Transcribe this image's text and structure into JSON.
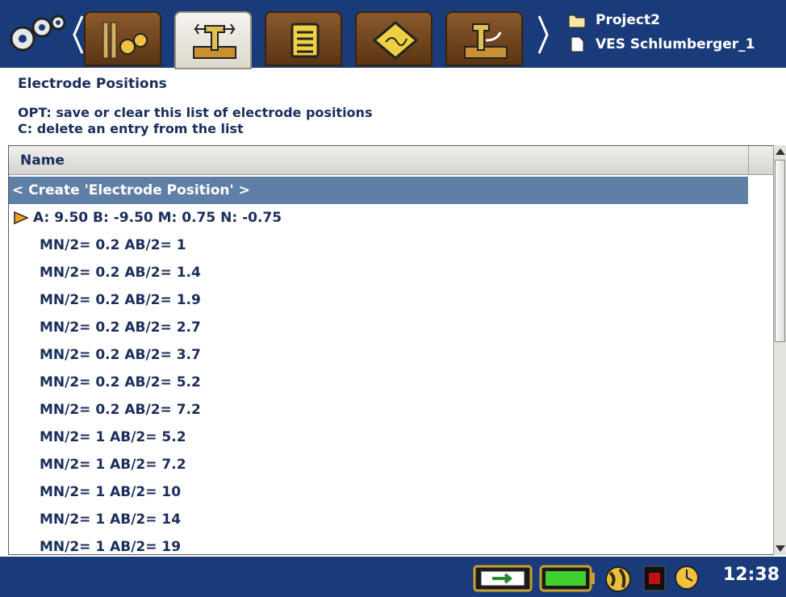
{
  "header": {
    "project_name": "Project2",
    "survey_name": "VES Schlumberger_1",
    "tabs": [
      {
        "icon": "settings-geophones-icon",
        "active": false
      },
      {
        "icon": "survey-setup-icon",
        "active": true
      },
      {
        "icon": "notes-list-icon",
        "active": false
      },
      {
        "icon": "data-viewer-icon",
        "active": false
      },
      {
        "icon": "electrode-measure-icon",
        "active": false
      }
    ]
  },
  "page": {
    "title": "Electrode Positions",
    "help_line_1": "OPT: save or clear this list of electrode positions",
    "help_line_2": "C: delete an entry from the list"
  },
  "list": {
    "column_header": "Name",
    "create_item": "<  Create 'Electrode Position' >",
    "items": [
      "A: 9.50 B: -9.50 M: 0.75 N: -0.75",
      "MN/2= 0.2 AB/2= 1",
      "MN/2= 0.2 AB/2= 1.4",
      "MN/2= 0.2 AB/2= 1.9",
      "MN/2= 0.2 AB/2= 2.7",
      "MN/2= 0.2 AB/2= 3.7",
      "MN/2= 0.2 AB/2= 5.2",
      "MN/2= 0.2 AB/2= 7.2",
      "MN/2= 1 AB/2= 5.2",
      "MN/2= 1 AB/2= 7.2",
      "MN/2= 1 AB/2= 10",
      "MN/2= 1 AB/2= 14",
      "MN/2= 1 AB/2= 19"
    ]
  },
  "status": {
    "time": "12:38",
    "icons": [
      "power-plug-icon",
      "battery-icon",
      "globe-alarm-icon",
      "record-icon",
      "clock-icon"
    ]
  },
  "colors": {
    "bar_blue": "#1a3b7a",
    "selection_blue": "#5f7fa6",
    "text_navy": "#1a2e5a",
    "marker_orange": "#f0a020"
  }
}
